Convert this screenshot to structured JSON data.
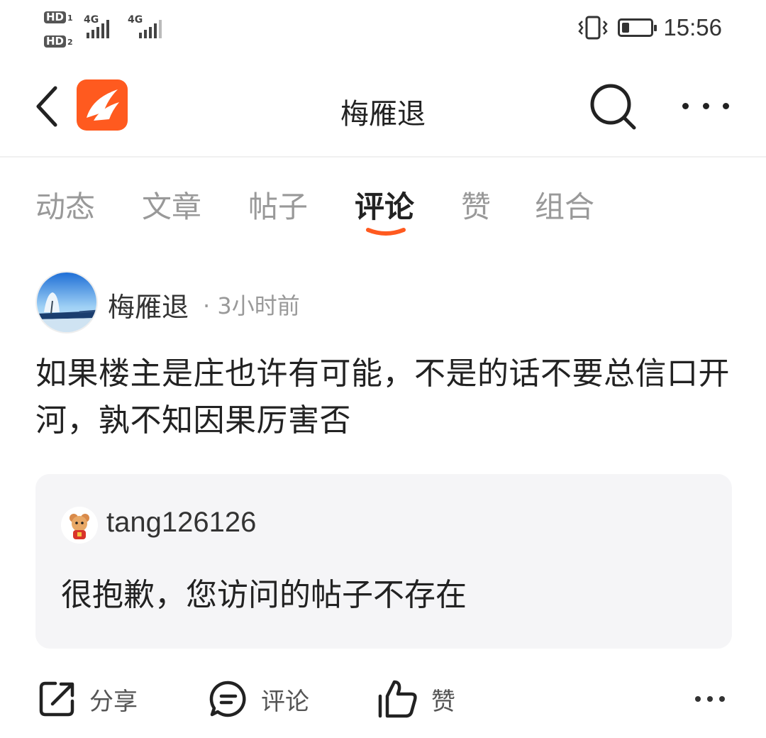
{
  "status_bar": {
    "sim1_badge": "HD",
    "sim1_num": "1",
    "sim2_badge": "HD",
    "sim2_num": "2",
    "net1": "4G",
    "net2": "4G",
    "time": "15:56",
    "battery_level": 0.25,
    "icons": [
      "vibrate-icon",
      "battery-icon",
      "signal-icon"
    ]
  },
  "nav": {
    "title": "梅雁退",
    "icons": [
      "back-arrow-icon",
      "app-logo-icon",
      "search-icon",
      "more-icon"
    ],
    "accent": "#ff5a1f"
  },
  "tabs": [
    {
      "label": "动态",
      "active": false
    },
    {
      "label": "文章",
      "active": false
    },
    {
      "label": "帖子",
      "active": false
    },
    {
      "label": "评论",
      "active": true
    },
    {
      "label": "赞",
      "active": false
    },
    {
      "label": "组合",
      "active": false
    }
  ],
  "comment": {
    "author": "梅雁退",
    "meta": "· 3小时前",
    "text": "如果楼主是庄也许有可能，不是的话不要总信口开河，孰不知因果厉害否",
    "quote": {
      "user": "tang126126",
      "text": "很抱歉，您访问的帖子不存在"
    }
  },
  "actions": {
    "share": "分享",
    "comment": "评论",
    "like": "赞",
    "icons": [
      "share-icon",
      "comment-icon",
      "like-icon",
      "more-icon"
    ]
  },
  "colors": {
    "accent": "#ff5a1f",
    "text": "#222222",
    "muted": "#999999",
    "quote_bg": "#f5f5f7"
  }
}
